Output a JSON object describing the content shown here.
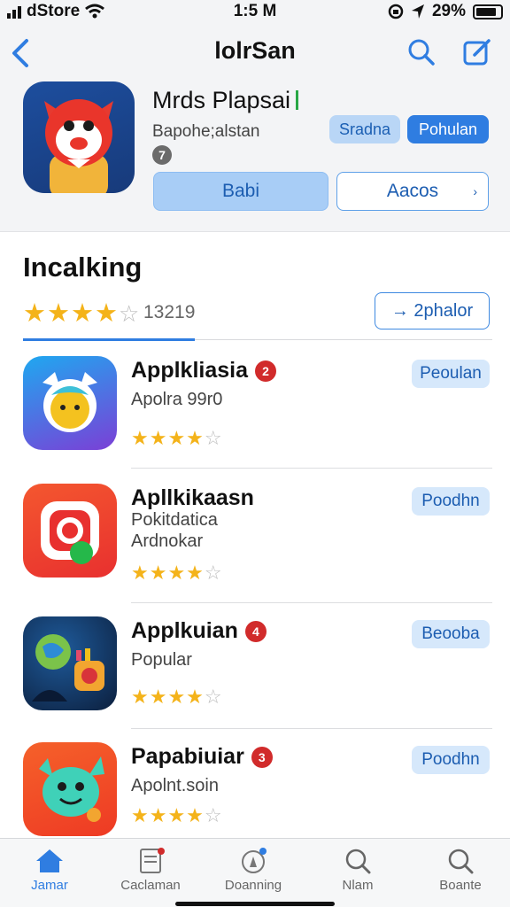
{
  "status_bar": {
    "carrier": "dStore",
    "time": "1:5 M",
    "battery": "29%"
  },
  "header": {
    "title": "lolrSan",
    "back_icon": "chevron-left-icon",
    "search_icon": "search-icon",
    "edit_icon": "compose-icon"
  },
  "featured": {
    "title": "Mrds Plapsai",
    "subtitle": "Bapohe;alstan",
    "badge": "7",
    "chips": [
      "Sradna",
      "Pohulan"
    ],
    "primary_button": "Babi",
    "secondary_button": "Aacos",
    "secondary_arrow": "›"
  },
  "ranking": {
    "title": "Incalking",
    "rating_stars": 4,
    "rating_count": "13219",
    "filter_button": "→ 2phalor"
  },
  "apps": [
    {
      "name": "Applkliasia",
      "badge": "2",
      "lines": [
        "Apolra 99r0"
      ],
      "stars": 4,
      "pill": "Peoulan"
    },
    {
      "name": "Apllkikaasn",
      "badge": "",
      "lines": [
        "Pokitdatica",
        "Ardnokar"
      ],
      "stars": 4,
      "pill": "Poodhn"
    },
    {
      "name": "Applkuian",
      "badge": "4",
      "lines": [
        "Popular"
      ],
      "stars": 4,
      "pill": "Beooba"
    },
    {
      "name": "Papabiuiar",
      "badge": "3",
      "lines": [
        "Apolnt.soin"
      ],
      "stars": 4,
      "pill": "Poodhn"
    }
  ],
  "tabbar": {
    "items": [
      {
        "label": "Jamar",
        "icon": "home-icon",
        "active": true
      },
      {
        "label": "Caclaman",
        "icon": "document-icon",
        "active": false
      },
      {
        "label": "Doanning",
        "icon": "compass-icon",
        "active": false
      },
      {
        "label": "Nlam",
        "icon": "search-icon",
        "active": false
      },
      {
        "label": "Boante",
        "icon": "search-icon",
        "active": false
      }
    ]
  },
  "colors": {
    "accent": "#2f7de1",
    "star": "#f4b31a",
    "badge_red": "#d12b2b",
    "pill_bg": "#d6e8fb"
  }
}
